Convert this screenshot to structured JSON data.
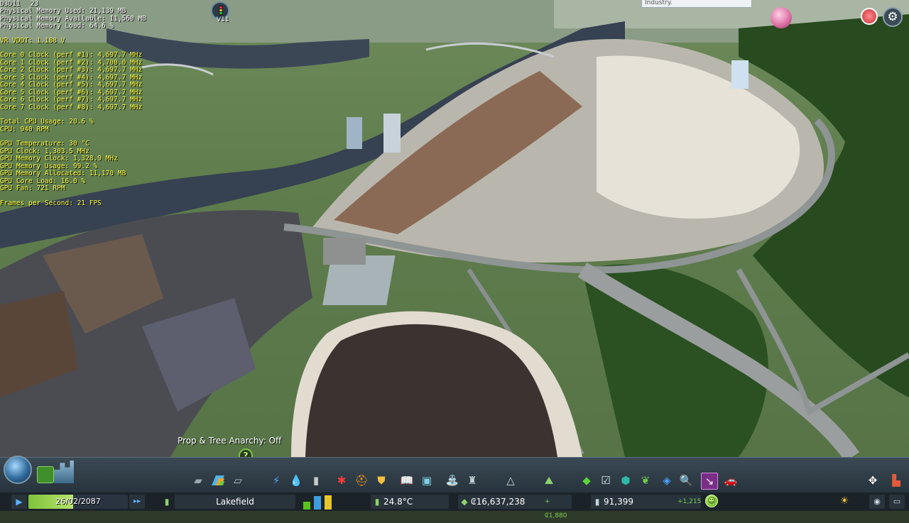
{
  "overlay": {
    "top_left_id": "D3D11",
    "fps_small": "23",
    "memory": [
      "Physical Memory Used: 21,139 MB",
      "Physical Memory Available: 11,560 MB",
      "Physical Memory Load: 64.6 %"
    ],
    "vr_vddt": "VR VDDT: 1.188 V",
    "cores": [
      "Core 0 Clock (perf #1): 4,697.7 MHz",
      "Core 1 Clock (perf #2): 4,700.0 MHz",
      "Core 2 Clock (perf #3): 4,697.7 MHz",
      "Core 3 Clock (perf #4): 4,697.7 MHz",
      "Core 4 Clock (perf #5): 4,697.7 MHz",
      "Core 5 Clock (perf #6): 4,697.7 MHz",
      "Core 6 Clock (perf #7): 4,697.7 MHz",
      "Core 7 Clock (perf #8): 4,697.7 MHz"
    ],
    "cpu": [
      "Total CPU Usage: 20.6 %",
      "CPU: 940 RPM"
    ],
    "gpu": [
      "GPU Temperature: 30 °C",
      "GPU Clock: 1,303.5 MHz",
      "GPU Memory Clock: 1,328.9 MHz",
      "GPU Memory Usage: 99.2 %",
      "GPU Memory Allocated: 11,170 MB",
      "GPU Core Load: 16.0 %",
      "GPU Fan: 721 RPM"
    ],
    "fps": "Frames per Second: 21 FPS"
  },
  "top": {
    "version_label": "V11",
    "chirp_text": "Industry."
  },
  "status_message": "Prop & Tree Anarchy: Off",
  "help_label": "?",
  "toolbar": {
    "icons": [
      "roads-icon",
      "zoning-icon",
      "districts-icon",
      "electricity-icon",
      "water-icon",
      "garbage-icon",
      "healthcare-icon",
      "fire-department-icon",
      "police-icon",
      "education-icon",
      "public-transport-icon",
      "parks-icon",
      "unique-buildings-icon",
      "monuments-icon",
      "wonders-icon",
      "landscaping-icon",
      "move-it-icon",
      "checklist-icon",
      "asset-icon",
      "tree-brush-icon",
      "surface-painter-icon",
      "find-it-icon",
      "selected-tool-icon",
      "vehicle-icon"
    ]
  },
  "statusbar": {
    "date": "26/02/2087",
    "date_progress": 0.45,
    "city_name": "Lakefield",
    "temperature": "24.8°C",
    "money": "₢16,637,238",
    "money_delta": "+₢1,880",
    "population": "91,399",
    "population_delta": "+1,215",
    "demand": {
      "residential": 0.55,
      "commercial": 0.95,
      "industrial": 1.0
    }
  },
  "colors": {
    "overlay_text": "#ffff40",
    "accent_green": "#7fc23a",
    "residential": "#5ac31e",
    "commercial": "#3b9de0",
    "industrial": "#e6c52b"
  }
}
